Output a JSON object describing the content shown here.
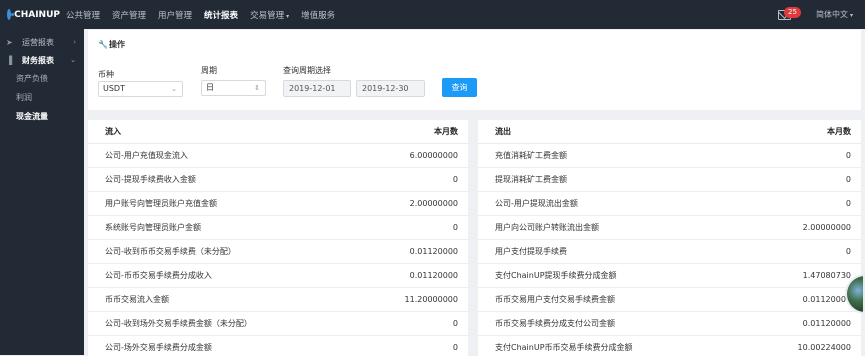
{
  "header": {
    "logo_text": "CHAINUP",
    "nav": [
      {
        "label": "公共管理",
        "dropdown": false,
        "active": false
      },
      {
        "label": "资产管理",
        "dropdown": false,
        "active": false
      },
      {
        "label": "用户管理",
        "dropdown": false,
        "active": false
      },
      {
        "label": "统计报表",
        "dropdown": false,
        "active": true
      },
      {
        "label": "交易管理",
        "dropdown": true,
        "active": false
      },
      {
        "label": "增值服务",
        "dropdown": false,
        "active": false
      }
    ],
    "badge_count": "25",
    "language": "简体中文",
    "caret": "▾"
  },
  "sidebar": {
    "groups": [
      {
        "label": "运营报表",
        "icon": "send-icon",
        "arrow": "›"
      },
      {
        "label": "财务报表",
        "icon": "bar-chart-icon",
        "arrow": "⌄"
      }
    ],
    "items": [
      {
        "label": "资产负债"
      },
      {
        "label": "利润"
      },
      {
        "label": "现金流量"
      }
    ]
  },
  "operations": {
    "title": "操作",
    "currency": {
      "label": "币种",
      "value": "USDT"
    },
    "period": {
      "label": "周期",
      "value": "日"
    },
    "range": {
      "label": "查询周期选择",
      "start": "2019-12-01",
      "end": "2019-12-30"
    },
    "query_button": "查询"
  },
  "inflow": {
    "header": {
      "name": "流入",
      "value": "本月数"
    },
    "rows": [
      {
        "name": "公司-用户充值现金流入",
        "value": "6.00000000"
      },
      {
        "name": "公司-提现手续费收入金额",
        "value": "0"
      },
      {
        "name": "用户账号向管理员账户充值金额",
        "value": "2.00000000"
      },
      {
        "name": "系统账号向管理员账户金额",
        "value": "0"
      },
      {
        "name": "公司-收到币币交易手续费（未分配）",
        "value": "0.01120000"
      },
      {
        "name": "公司-币币交易手续费分成收入",
        "value": "0.01120000"
      },
      {
        "name": "币币交易流入金额",
        "value": "11.20000000"
      },
      {
        "name": "公司-收到场外交易手续费金额（未分配）",
        "value": "0"
      },
      {
        "name": "公司-场外交易手续费分成金额",
        "value": "0"
      }
    ]
  },
  "outflow": {
    "header": {
      "name": "流出",
      "value": "本月数"
    },
    "rows": [
      {
        "name": "充值消耗矿工费金额",
        "value": "0"
      },
      {
        "name": "提现消耗矿工费金额",
        "value": "0"
      },
      {
        "name": "公司-用户提现流出金额",
        "value": "0"
      },
      {
        "name": "用户向公司账户转账流出金额",
        "value": "2.00000000"
      },
      {
        "name": "用户支付提现手续费",
        "value": "0"
      },
      {
        "name": "支付ChainUP提现手续费分成金额",
        "value": "1.47080730"
      },
      {
        "name": "币币交易用户支付交易手续费金额",
        "value": "0.01120000"
      },
      {
        "name": "币币交易手续费分成支付公司金额",
        "value": "0.01120000"
      },
      {
        "name": "支付ChainUP币币交易手续费分成金额",
        "value": "10.00224000"
      }
    ]
  }
}
